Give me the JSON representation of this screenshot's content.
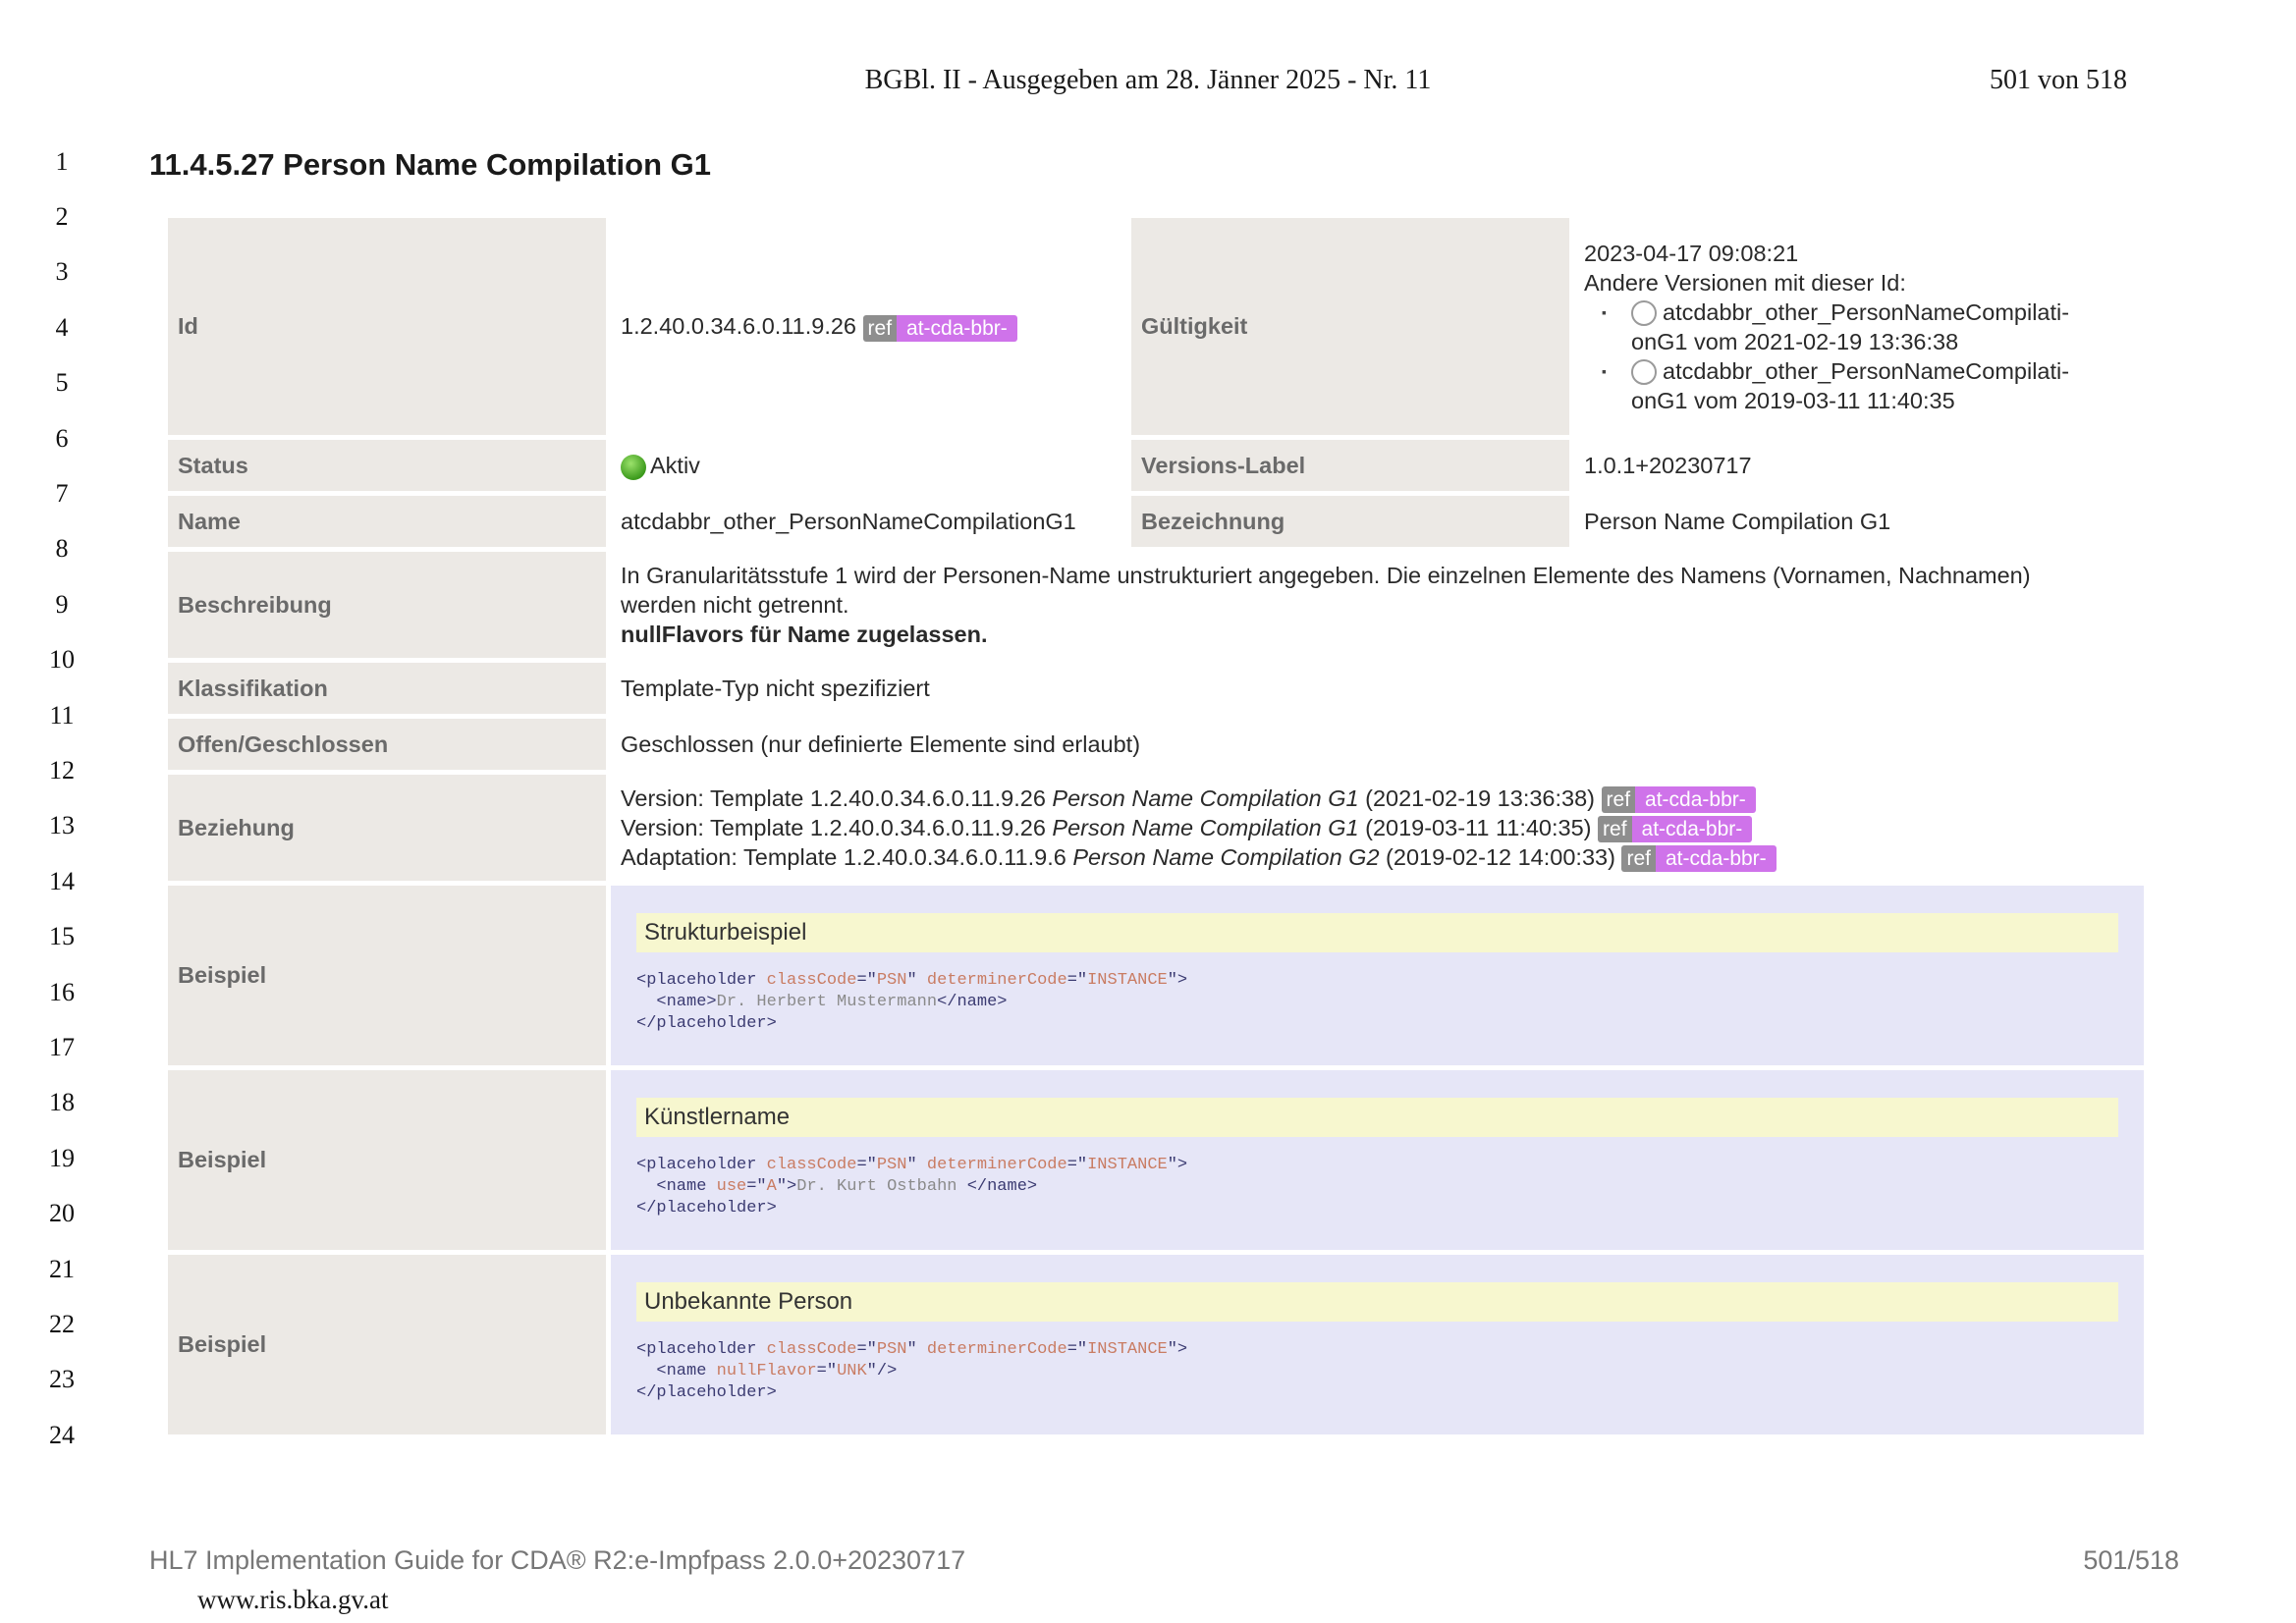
{
  "gazette": {
    "title": "BGBl. II - Ausgegeben am 28. Jänner 2025 - Nr. 11",
    "page": "501 von 518"
  },
  "line_numbers": [
    "1",
    "2",
    "3",
    "4",
    "5",
    "6",
    "7",
    "8",
    "9",
    "10",
    "11",
    "12",
    "13",
    "14",
    "15",
    "16",
    "17",
    "18",
    "19",
    "20",
    "21",
    "22",
    "23",
    "24"
  ],
  "section": {
    "title": "11.4.5.27 Person Name Compilation G1"
  },
  "badge": {
    "ref": "ref",
    "tag": "at-cda-bbr-"
  },
  "rows": {
    "id": {
      "label": "Id",
      "value": "1.2.40.0.34.6.0.11.9.26"
    },
    "validity": {
      "label": "Gültigkeit",
      "date": "2023‑04‑17 09:08:21",
      "other_versions": "Andere Versionen mit dieser Id:",
      "versions": [
        {
          "line1": "atcdabbr_other_PersonNameCompilati-",
          "line2": "onG1 vom 2021‑02‑19 13:36:38"
        },
        {
          "line1": "atcdabbr_other_PersonNameCompilati-",
          "line2": "onG1 vom 2019‑03‑11 11:40:35"
        }
      ]
    },
    "status": {
      "label": "Status",
      "value": "Aktiv"
    },
    "version_label": {
      "label": "Versions-Label",
      "value": "1.0.1+20230717"
    },
    "name": {
      "label": "Name",
      "value": "atcdabbr_other_PersonNameCompilationG1"
    },
    "designation": {
      "label": "Bezeichnung",
      "value": "Person Name Compilation G1"
    },
    "description": {
      "label": "Beschreibung",
      "text1": "In Granularitätsstufe 1 wird der Personen-Name unstrukturiert angegeben. Die einzelnen Elemente des Namens (Vornamen, Nachnamen)",
      "text2": "werden nicht getrennt.",
      "bold": "nullFlavors für Name zugelassen."
    },
    "classification": {
      "label": "Klassifikation",
      "value": "Template-Typ nicht spezifiziert"
    },
    "open_closed": {
      "label": "Offen/Geschlossen",
      "value": "Geschlossen (nur definierte Elemente sind erlaubt)"
    },
    "relation": {
      "label": "Beziehung",
      "items": [
        {
          "prefix": "Version: Template 1.2.40.0.34.6.0.11.9.26 ",
          "name": "Person Name Compilation G1",
          "suffix": " (2021‑02‑19 13:36:38)"
        },
        {
          "prefix": "Version: Template 1.2.40.0.34.6.0.11.9.26 ",
          "name": "Person Name Compilation G1",
          "suffix": " (2019‑03‑11 11:40:35)"
        },
        {
          "prefix": "Adaptation: Template 1.2.40.0.34.6.0.11.9.6 ",
          "name": "Person Name Compilation G2",
          "suffix": " (2019‑02‑12 14:00:33)"
        }
      ]
    }
  },
  "examples": [
    {
      "label": "Beispiel",
      "title": "Strukturbeispiel",
      "code": {
        "l1_open": "<placeholder ",
        "l1_a1": "classCode",
        "l1_eq1": "=\"",
        "l1_v1": "PSN",
        "l1_mid": "\" ",
        "l1_a2": "determinerCode",
        "l1_eq2": "=\"",
        "l1_v2": "INSTANCE",
        "l1_close": "\">",
        "l2_open": "  <name>",
        "l2_txt": "Dr. Herbert Mustermann",
        "l2_close": "</name>",
        "l3": "</placeholder>"
      }
    },
    {
      "label": "Beispiel",
      "title": "Künstlername",
      "code": {
        "l1_open": "<placeholder ",
        "l1_a1": "classCode",
        "l1_eq1": "=\"",
        "l1_v1": "PSN",
        "l1_mid": "\" ",
        "l1_a2": "determinerCode",
        "l1_eq2": "=\"",
        "l1_v2": "INSTANCE",
        "l1_close": "\">",
        "l2_open": "  <name ",
        "l2_a1": "use",
        "l2_eq1": "=\"",
        "l2_v1": "A",
        "l2_gt": "\">",
        "l2_txt": "Dr. Kurt Ostbahn ",
        "l2_close": "</name>",
        "l3": "</placeholder>"
      }
    },
    {
      "label": "Beispiel",
      "title": "Unbekannte Person",
      "code": {
        "l1_open": "<placeholder ",
        "l1_a1": "classCode",
        "l1_eq1": "=\"",
        "l1_v1": "PSN",
        "l1_mid": "\" ",
        "l1_a2": "determinerCode",
        "l1_eq2": "=\"",
        "l1_v2": "INSTANCE",
        "l1_close": "\">",
        "l2_open": "  <name ",
        "l2_a1": "nullFlavor",
        "l2_eq1": "=\"",
        "l2_v1": "UNK",
        "l2_close": "\"/>",
        "l3": "</placeholder>"
      }
    }
  ],
  "footer": {
    "left": "HL7 Implementation Guide for CDA® R2:e-Impfpass 2.0.0+20230717",
    "right": "501/518",
    "url": "www.ris.bka.gv.at"
  }
}
